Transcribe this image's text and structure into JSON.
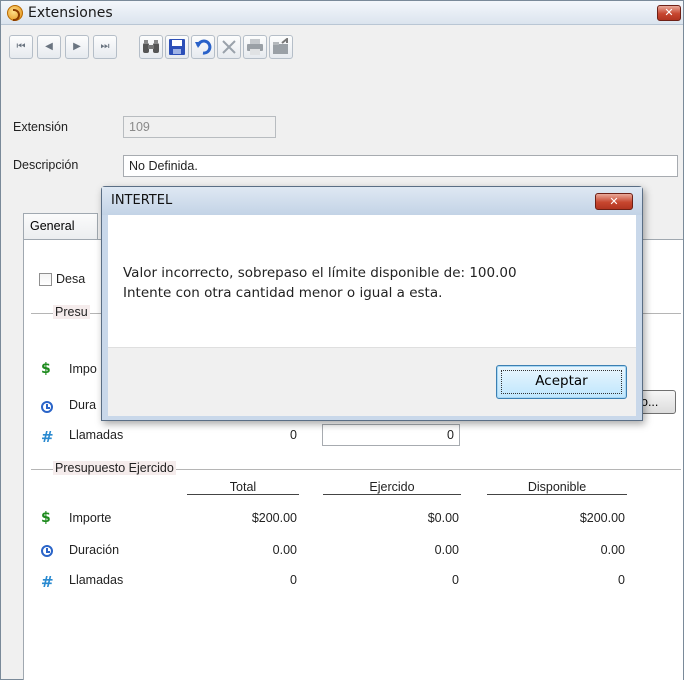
{
  "window": {
    "title": "Extensiones",
    "close_label": "✕"
  },
  "toolbar": {
    "first": "⏮",
    "prev": "◀",
    "next": "▶",
    "last": "⏭"
  },
  "form": {
    "extension_label": "Extensión",
    "extension_value": "109",
    "description_label": "Descripción",
    "description_value": "No Definida."
  },
  "tabs": {
    "general": "General"
  },
  "general": {
    "checkbox_label": "Desa",
    "group_title": "Presu",
    "rows": [
      {
        "label": "Impo"
      },
      {
        "label": "Dura"
      },
      {
        "label": "Llamadas",
        "value": "0",
        "input_value": "0"
      }
    ],
    "partial_button": "o..."
  },
  "ejercido": {
    "group_title": "Presupuesto Ejercido",
    "columns": [
      "Total",
      "Ejercido",
      "Disponible"
    ],
    "rows": [
      {
        "label": "Importe",
        "values": [
          "$200.00",
          "$0.00",
          "$200.00"
        ]
      },
      {
        "label": "Duración",
        "values": [
          "0.00",
          "0.00",
          "0.00"
        ]
      },
      {
        "label": "Llamadas",
        "values": [
          "0",
          "0",
          "0"
        ]
      }
    ]
  },
  "dialog": {
    "title": "INTERTEL",
    "close_label": "✕",
    "message_line1": "Valor incorrecto, sobrepaso el límite disponible de: 100.00",
    "message_line2": "Intente con otra cantidad menor o igual a esta.",
    "ok_label": "Aceptar"
  },
  "colors": {
    "dollar_icon": "#1d8a1d",
    "clock_icon": "#2a64c8",
    "hash_icon": "#2a8ad0",
    "group_title_bg": "#f5ecec"
  },
  "icons": {
    "dollar": "$",
    "hash": "#"
  }
}
